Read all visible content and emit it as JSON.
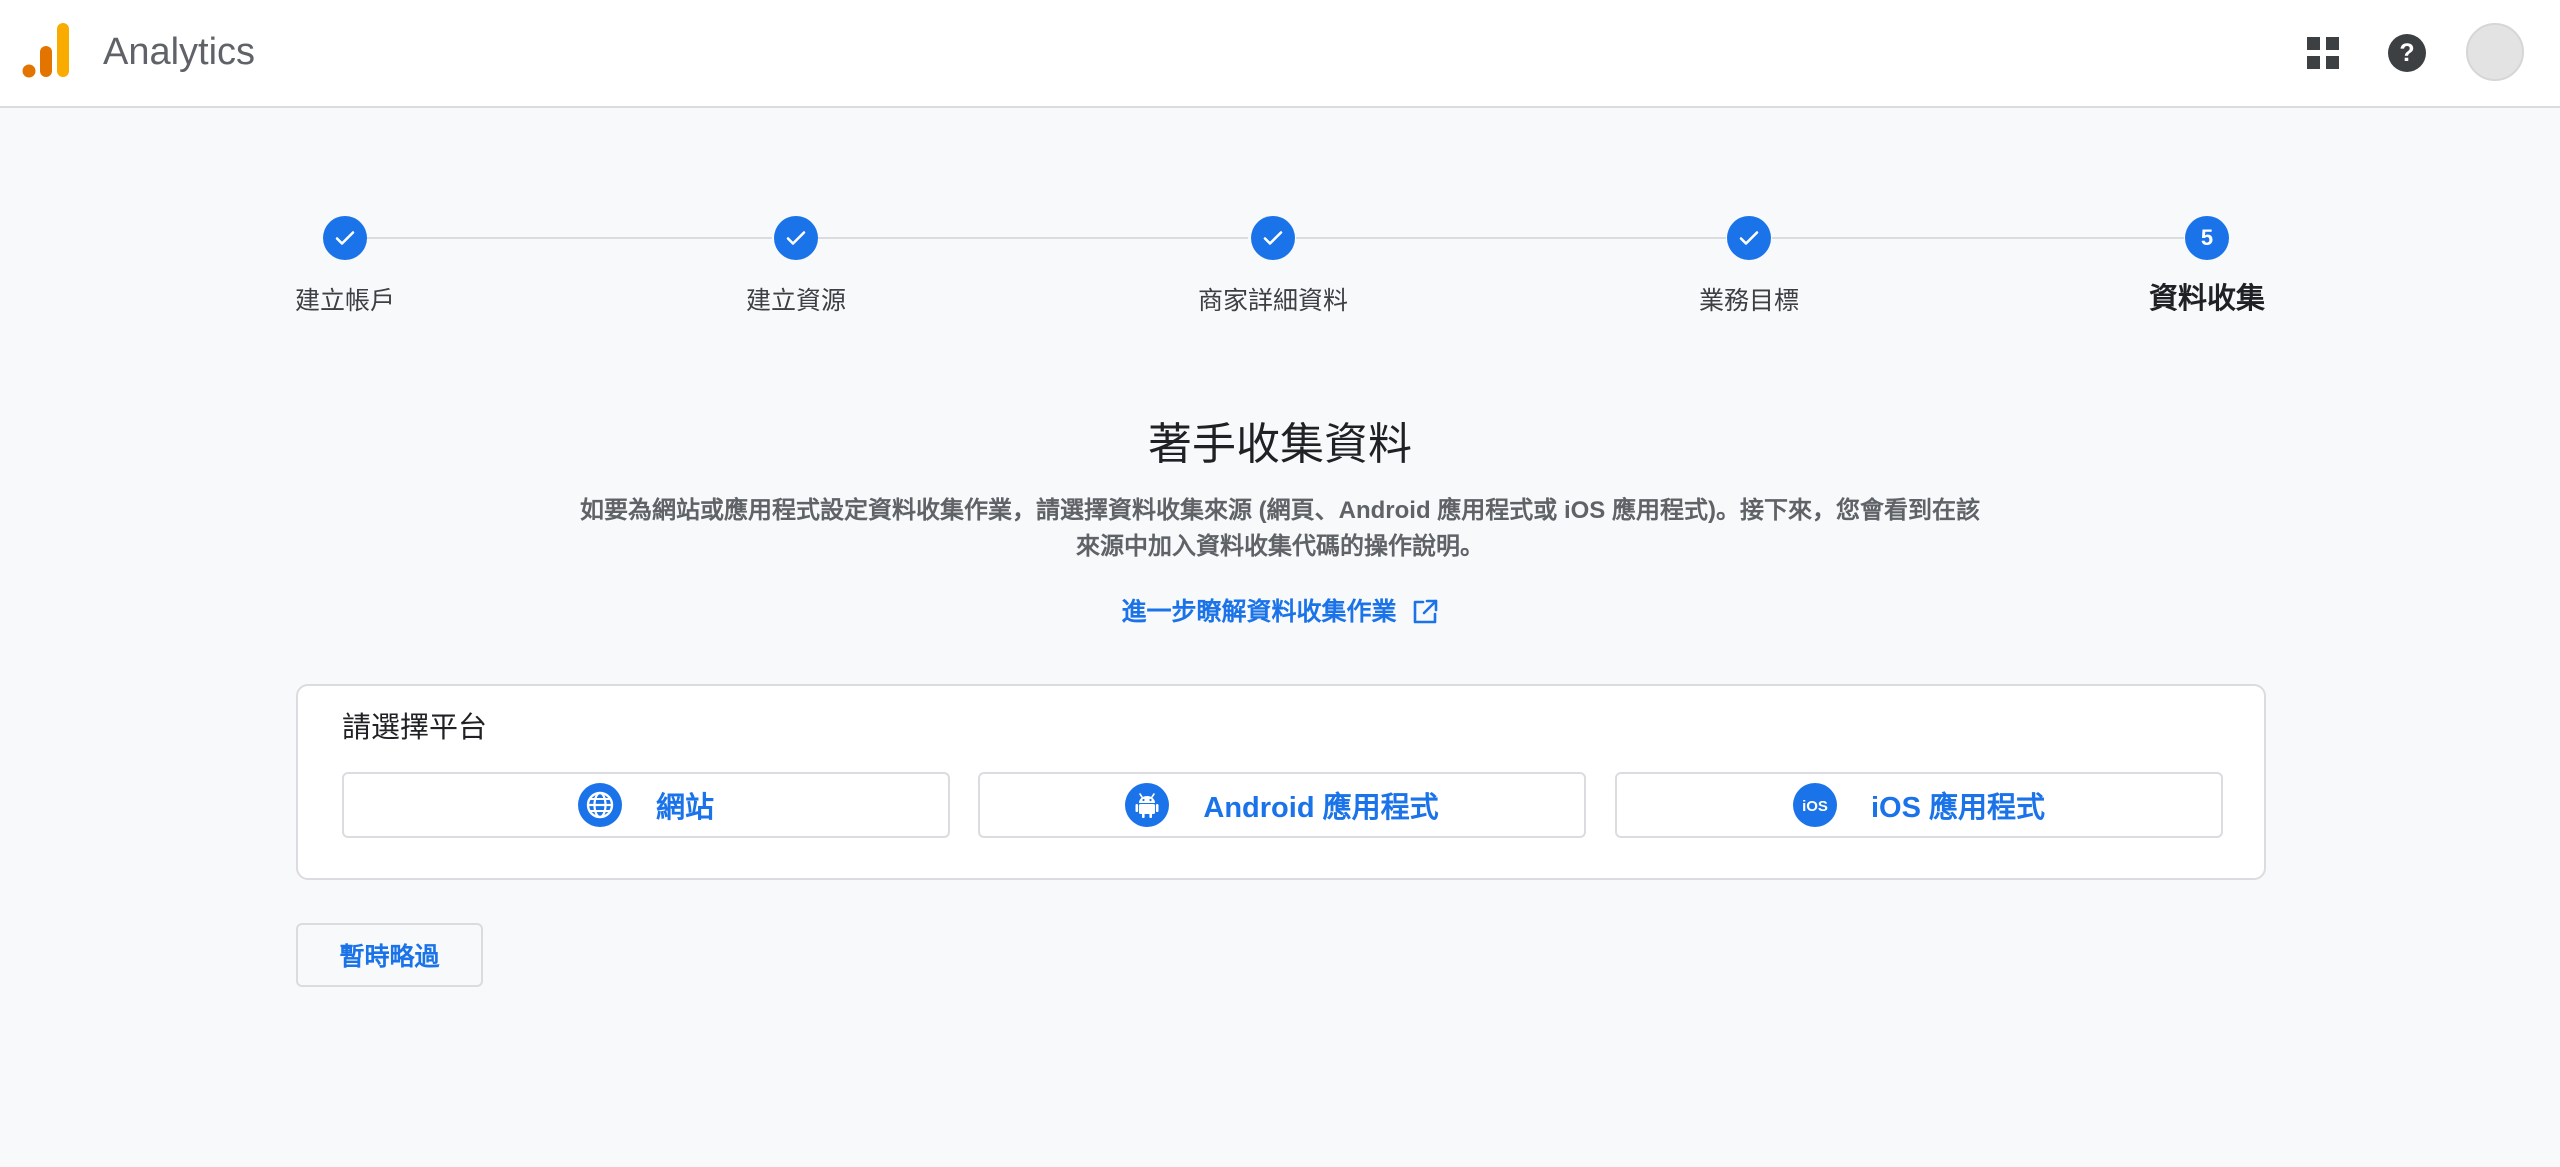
{
  "header": {
    "app_title": "Analytics",
    "logo_colors": [
      "#e37400",
      "#f9ab00"
    ],
    "icons": [
      "apps-grid-icon",
      "help-icon",
      "account-avatar"
    ]
  },
  "stepper": {
    "steps": [
      {
        "label": "建立帳戶",
        "status": "done"
      },
      {
        "label": "建立資源",
        "status": "done"
      },
      {
        "label": "商家詳細資料",
        "status": "done"
      },
      {
        "label": "業務目標",
        "status": "done"
      },
      {
        "label": "資料收集",
        "status": "current",
        "number": "5"
      }
    ]
  },
  "main": {
    "title": "著手收集資料",
    "description": "如要為網站或應用程式設定資料收集作業，請選擇資料收集來源 (網頁、Android 應用程式或 iOS 應用程式)。接下來，您會看到在該來源中加入資料收集代碼的操作說明。",
    "learn_more": "進一步瞭解資料收集作業"
  },
  "platform": {
    "title": "請選擇平台",
    "options": [
      {
        "label": "網站",
        "icon": "globe-icon"
      },
      {
        "label": "Android 應用程式",
        "icon": "android-icon"
      },
      {
        "label": "iOS 應用程式",
        "icon": "ios-icon"
      }
    ]
  },
  "skip_label": "暫時略過",
  "colors": {
    "accent": "#1a73e8",
    "background": "#f8f9fa",
    "border": "#dadce0"
  }
}
